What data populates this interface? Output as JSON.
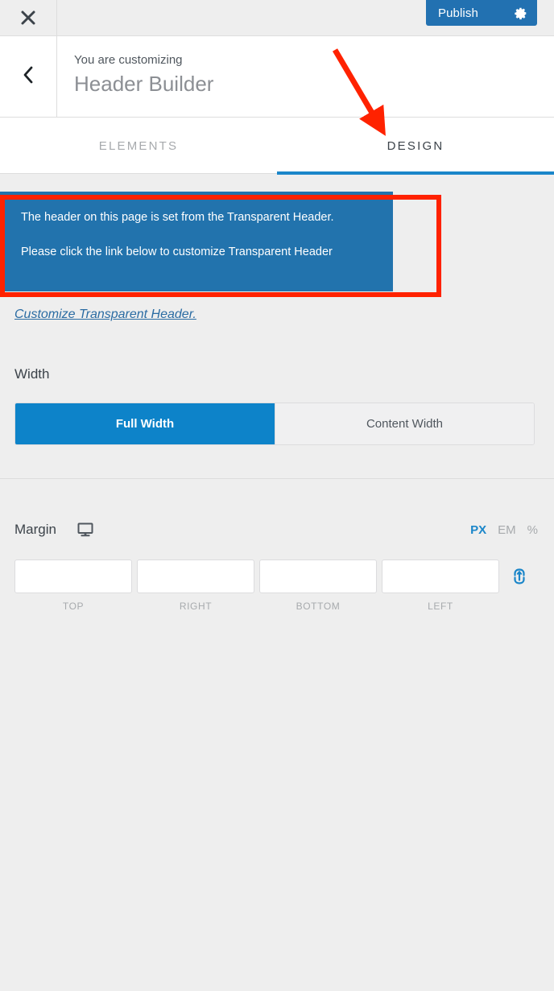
{
  "topbar": {
    "close_icon": "close-icon",
    "publish_label": "Publish",
    "gear_icon": "gear-icon"
  },
  "panel": {
    "back_icon": "chevron-left-icon",
    "eyebrow": "You are customizing",
    "title": "Header Builder"
  },
  "tabs": [
    {
      "label": "ELEMENTS",
      "active": false
    },
    {
      "label": "DESIGN",
      "active": true
    }
  ],
  "notice": {
    "line1": "The header on this page is set from the Transparent Header.",
    "line2": "Please click the link below to customize Transparent Header",
    "link": "Customize Transparent Header.",
    "background": "#2273ad"
  },
  "width": {
    "label": "Width",
    "options": [
      {
        "label": "Full Width",
        "active": true
      },
      {
        "label": "Content Width",
        "active": false
      }
    ]
  },
  "margin": {
    "label": "Margin",
    "device_icon": "desktop-monitor-icon",
    "units": [
      {
        "label": "PX",
        "active": true
      },
      {
        "label": "EM",
        "active": false
      },
      {
        "label": "%",
        "active": false
      }
    ],
    "fields": [
      {
        "sub": "TOP",
        "value": "",
        "placeholder": ""
      },
      {
        "sub": "RIGHT",
        "value": "",
        "placeholder": ""
      },
      {
        "sub": "BOTTOM",
        "value": "",
        "placeholder": ""
      },
      {
        "sub": "LEFT",
        "value": "",
        "placeholder": ""
      }
    ],
    "link_icon": "link-chain-icon"
  },
  "colors": {
    "accent_blue": "#1b86c9",
    "publish_blue": "#2271b1",
    "annotation_red": "#ff2200"
  }
}
